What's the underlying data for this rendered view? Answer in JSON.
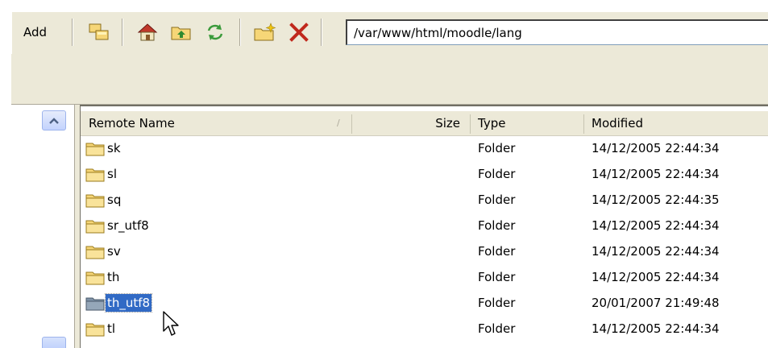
{
  "toolbar": {
    "add_label": "Add",
    "path_value": "/var/www/html/moodle/lang",
    "icons": [
      "copy-icon",
      "home-icon",
      "parent-folder-icon",
      "refresh-icon",
      "new-folder-icon",
      "delete-icon"
    ]
  },
  "list": {
    "columns": {
      "name": "Remote Name",
      "size": "Size",
      "type": "Type",
      "modified": "Modified"
    },
    "sort_column": "name",
    "rows": [
      {
        "name": "sk",
        "type": "Folder",
        "modified": "14/12/2005 22:44:34"
      },
      {
        "name": "sl",
        "type": "Folder",
        "modified": "14/12/2005 22:44:34"
      },
      {
        "name": "sq",
        "type": "Folder",
        "modified": "14/12/2005 22:44:35"
      },
      {
        "name": "sr_utf8",
        "type": "Folder",
        "modified": "14/12/2005 22:44:34"
      },
      {
        "name": "sv",
        "type": "Folder",
        "modified": "14/12/2005 22:44:34"
      },
      {
        "name": "th",
        "type": "Folder",
        "modified": "14/12/2005 22:44:34"
      },
      {
        "name": "th_utf8",
        "type": "Folder",
        "modified": "20/01/2007 21:49:48",
        "selected": true
      },
      {
        "name": "tl",
        "type": "Folder",
        "modified": "14/12/2005 22:44:34"
      }
    ]
  },
  "colors": {
    "toolbar_bg": "#ece9d8",
    "selection": "#316ac5",
    "folder": "#f6d677"
  }
}
